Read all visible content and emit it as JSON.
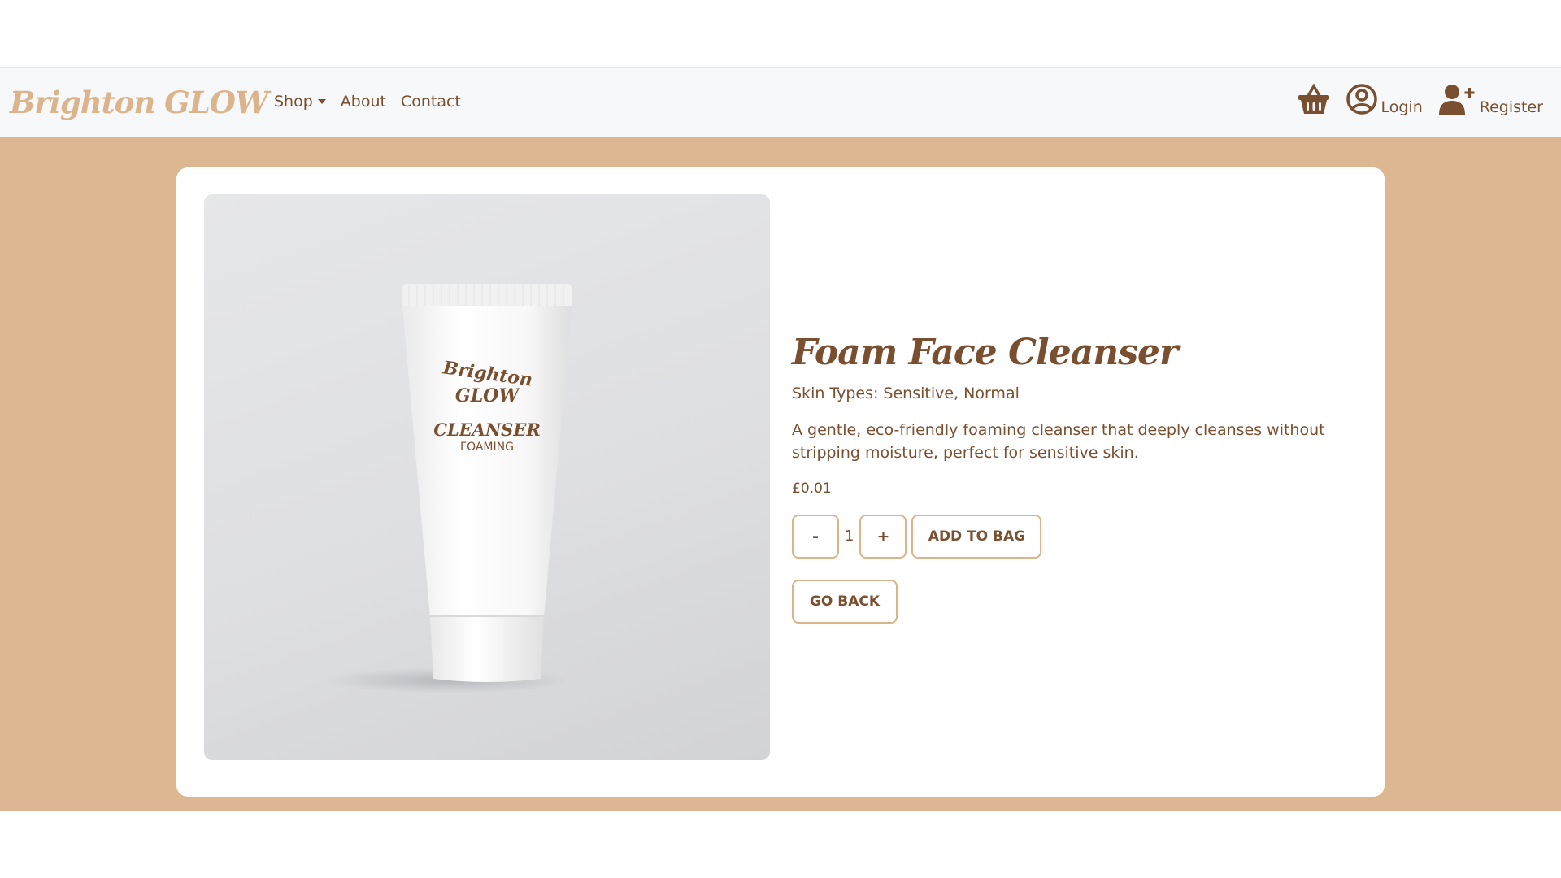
{
  "navbar": {
    "brand": "Brighton GLOW",
    "links": [
      {
        "label": "Shop"
      },
      {
        "label": "About"
      },
      {
        "label": "Contact"
      }
    ],
    "login_label": "Login",
    "register_label": "Register"
  },
  "product": {
    "title": "Foam Face Cleanser",
    "skin_types": "Skin Types: Sensitive, Normal",
    "description": "A gentle, eco-friendly foaming cleanser that deeply cleanses without stripping moisture, perfect for sensitive skin.",
    "price": "£0.01",
    "quantity": "1",
    "decrement_label": "-",
    "increment_label": "+",
    "add_to_bag_label": "ADD TO BAG",
    "go_back_label": "GO BACK",
    "image_text": {
      "brand_line1": "Brighton",
      "brand_line2": "GLOW",
      "product_line1": "CLEANSER",
      "product_line2": "FOAMING"
    }
  },
  "colors": {
    "brand_tan": "#dcb48b",
    "brown_text": "#7a4f2f",
    "page_band": "#ddb692",
    "navbar_bg": "#f7f8fa"
  },
  "icons": {
    "cart": "basket-icon",
    "login": "user-circle-icon",
    "register": "user-plus-icon",
    "shop_dropdown": "caret-down-icon"
  }
}
